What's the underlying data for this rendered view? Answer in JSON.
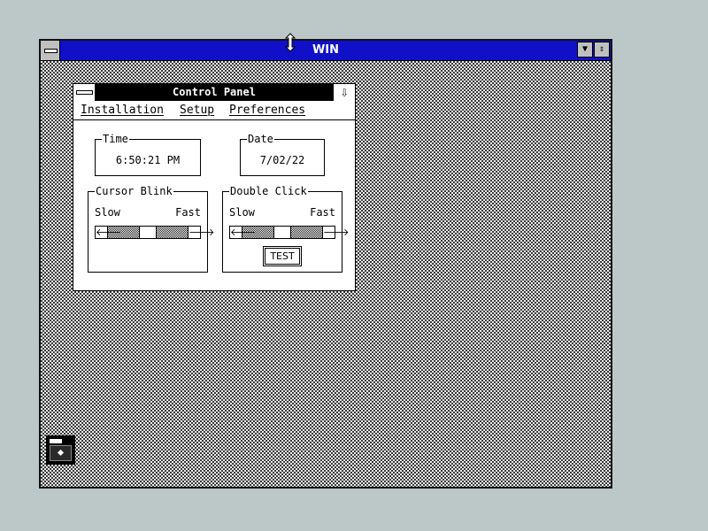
{
  "win_window": {
    "title": "WIN",
    "minimize_icon": "triangle-down-icon",
    "maximize_icon": "up-down-arrows-icon",
    "title_color": "#1010c8"
  },
  "control_panel": {
    "title": "Control Panel",
    "menu": {
      "installation": "Installation",
      "setup": "Setup",
      "preferences": "Preferences"
    },
    "time": {
      "label": "Time",
      "value": "6:50:21 PM"
    },
    "date": {
      "label": "Date",
      "value": "7/02/22"
    },
    "cursor_blink": {
      "label": "Cursor Blink",
      "slow": "Slow",
      "fast": "Fast",
      "position": 0.5
    },
    "double_click": {
      "label": "Double Click",
      "slow": "Slow",
      "fast": "Fast",
      "position": 0.5,
      "test_label": "TEST"
    }
  },
  "minimized_icon": {
    "name": "floppy-disk-icon"
  }
}
